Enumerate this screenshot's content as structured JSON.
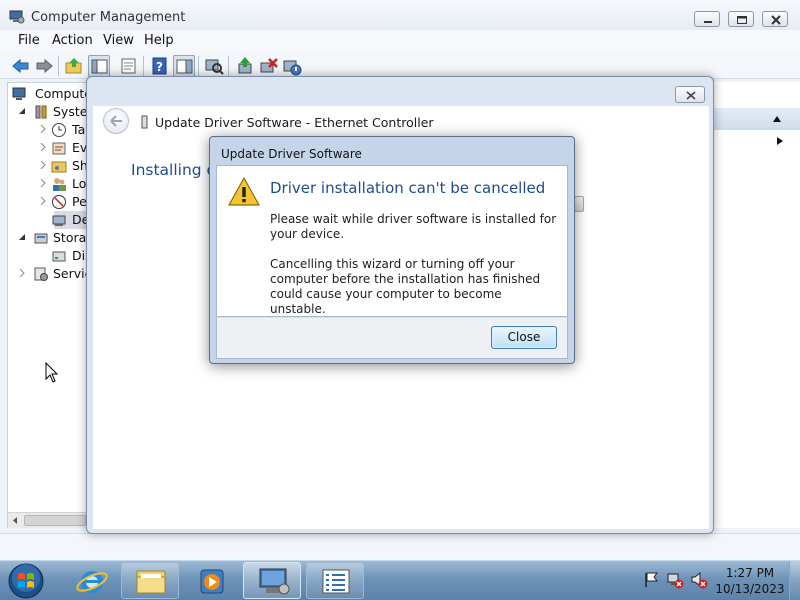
{
  "main_window": {
    "title": "Computer Management",
    "menu": [
      "File",
      "Action",
      "Help",
      "View"
    ],
    "toolbar_icons": [
      "back-icon",
      "forward-icon",
      "up-folder-icon",
      "show-hide-tree-icon",
      "properties-icon",
      "help-icon",
      "show-hide-action-pane-icon",
      "scan-hardware-icon",
      "update-driver-icon",
      "uninstall-icon",
      "enable-device-icon"
    ],
    "tree": [
      {
        "label": "Computer",
        "icon": "computer-icon"
      },
      {
        "label": "System",
        "icon": "tools-icon"
      },
      {
        "label": "Ta",
        "icon": "clock-icon"
      },
      {
        "label": "Eve",
        "icon": "event-viewer-icon"
      },
      {
        "label": "Sh",
        "icon": "shared-folder-icon"
      },
      {
        "label": "Lo",
        "icon": "users-icon"
      },
      {
        "label": "Pe",
        "icon": "performance-icon"
      },
      {
        "label": "De",
        "icon": "device-manager-icon"
      },
      {
        "label": "Storag",
        "icon": "storage-icon"
      },
      {
        "label": "Dis",
        "icon": "disk-icon"
      },
      {
        "label": "Service",
        "icon": "services-icon"
      }
    ]
  },
  "wizard": {
    "title": "Update Driver Software - Ethernet Controller",
    "status": "Installing d"
  },
  "dialog": {
    "title": "Update Driver Software",
    "heading": "Driver installation can't be cancelled",
    "paragraph1": "Please wait while driver software is installed for your device.",
    "paragraph2": "Cancelling this wizard or turning off your computer before the installation has finished could cause your computer to become unstable.",
    "close_label": "Close"
  },
  "taskbar": {
    "apps": [
      "start-orb-icon",
      "internet-explorer-icon",
      "windows-explorer-icon",
      "media-player-icon",
      "computer-management-icon",
      "task-list-icon"
    ],
    "tray": [
      "action-center-flag-icon",
      "network-disconnected-icon",
      "volume-muted-icon"
    ],
    "time": "1:27 PM",
    "date": "10/13/2023"
  },
  "colors": {
    "heading_blue": "#1f4b8f",
    "taskbar": "#6f93b8",
    "dialog_frame": "#c5d5e9"
  }
}
